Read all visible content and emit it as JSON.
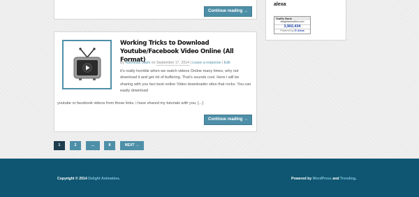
{
  "previous_post": {
    "continue_label": "Continue reading →"
  },
  "post": {
    "title": "Working Tricks to Download Youtube/Facebook Video Online (All Format)",
    "thumbnail_icon": "tv-play-icon",
    "meta_by": "By",
    "author": "Rashedul Islam",
    "meta_on": "on",
    "date": "September 17, 2014",
    "sep": "|",
    "leave_response": "Leave a response",
    "edit": "Edit",
    "excerpt_1": "it's really horrible when we watch videos Online many times, why not download it and get rid of buffering. That's sounds cool. Here i will be sharing with you two best online Video downloader sites that rocks. You can easily download",
    "excerpt_2": "youtube or facebook videos from those links. i have shared my tutorials with you, [...]",
    "continue_label": "Continue reading →"
  },
  "sidebar": {
    "heading": "alexa",
    "widget": {
      "label": "Traffic Rank",
      "site": "delightanimation.com",
      "rank": "3,902,434",
      "powered_by": "Powered by",
      "brand": "Alexa"
    }
  },
  "pagination": {
    "pages": [
      "1",
      "2",
      "...",
      "8"
    ],
    "next": "NEXT →",
    "current": "1"
  },
  "footer": {
    "copyright_prefix": "Copyright © 2014",
    "site_name": "Delight Animation",
    "period": ".",
    "powered_prefix": "Powered by",
    "wordpress": "WordPress",
    "and": "and",
    "theme": "Trending",
    "period2": "."
  },
  "colors": {
    "accent": "#4e8fa8",
    "pager_current": "#1e3d4f",
    "footer_bg": "#0e5671",
    "page_bg": "#ececec"
  }
}
